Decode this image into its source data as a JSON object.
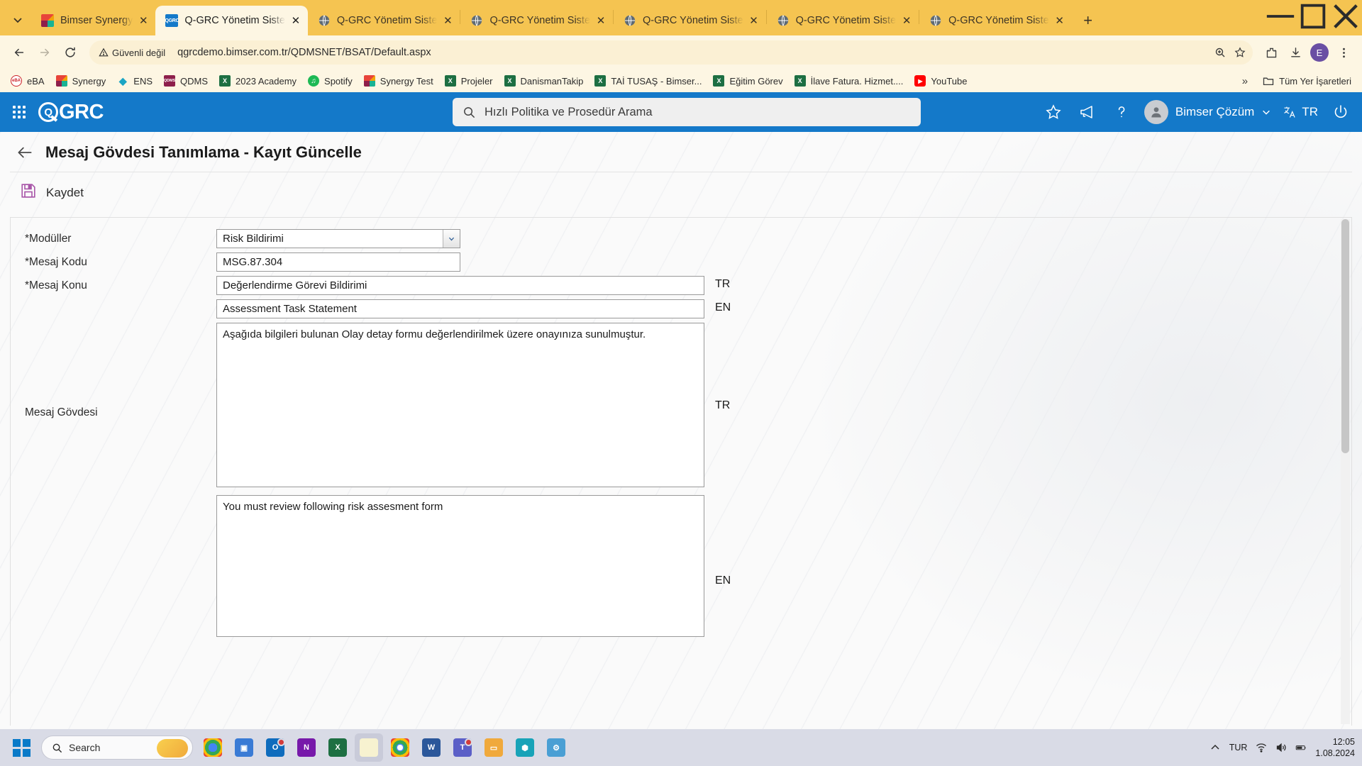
{
  "browser": {
    "tab_search_icon": "chevron-down-icon",
    "new_tab_label": "+",
    "tabs": [
      {
        "title": "Bimser Synergy",
        "favicon": "synergy-icon",
        "active": false
      },
      {
        "title": "Q-GRC Yönetim Siste",
        "favicon": "qgrc-icon",
        "active": true
      },
      {
        "title": "Q-GRC Yönetim Siste",
        "favicon": "globe-icon",
        "active": false
      },
      {
        "title": "Q-GRC Yönetim Siste",
        "favicon": "globe-icon",
        "active": false
      },
      {
        "title": "Q-GRC Yönetim Siste",
        "favicon": "globe-icon",
        "active": false
      },
      {
        "title": "Q-GRC Yönetim Siste",
        "favicon": "globe-icon",
        "active": false
      },
      {
        "title": "Q-GRC Yönetim Siste",
        "favicon": "globe-icon",
        "active": false
      }
    ],
    "window_controls": {
      "minimize": "minimize-icon",
      "maximize": "maximize-icon",
      "close": "close-icon"
    },
    "toolbar": {
      "back": "back-arrow-icon",
      "forward": "forward-arrow-icon",
      "reload": "reload-icon",
      "security_label": "Güvenli değil",
      "url": "qgrcdemo.bimser.com.tr/QDMSNET/BSAT/Default.aspx",
      "zoom_icon": "zoom-icon",
      "bookmark_star": "star-icon",
      "extensions": "extensions-icon",
      "downloads": "download-icon",
      "profile_initial": "E",
      "menu": "three-dot-menu-icon"
    },
    "bookmarks": [
      {
        "label": "eBA",
        "icon": "eba-icon"
      },
      {
        "label": "Synergy",
        "icon": "synergy-icon"
      },
      {
        "label": "ENS",
        "icon": "ens-icon"
      },
      {
        "label": "QDMS",
        "icon": "qdms-icon"
      },
      {
        "label": "2023 Academy",
        "icon": "excel-icon"
      },
      {
        "label": "Spotify",
        "icon": "spotify-icon"
      },
      {
        "label": "Synergy Test",
        "icon": "synergy-icon"
      },
      {
        "label": "Projeler",
        "icon": "excel-icon"
      },
      {
        "label": "DanismanTakip",
        "icon": "excel-icon"
      },
      {
        "label": "TAİ TUSAŞ - Bimser...",
        "icon": "excel-icon"
      },
      {
        "label": "Eğitim Görev",
        "icon": "excel-icon"
      },
      {
        "label": "İlave Fatura. Hizmet....",
        "icon": "excel-icon"
      },
      {
        "label": "YouTube",
        "icon": "youtube-icon"
      }
    ],
    "bookmarks_overflow": "»",
    "all_bookmarks_label": "Tüm Yer İşaretleri",
    "all_bookmarks_icon": "folder-icon"
  },
  "app_header": {
    "apps_grid_icon": "apps-grid-icon",
    "brand": "GRC",
    "brand_mark": "Q",
    "search_placeholder": "Hızlı Politika ve Prosedür Arama",
    "search_icon": "search-icon",
    "favorites_icon": "star-icon",
    "announcements_icon": "megaphone-icon",
    "help_icon": "question-mark-icon",
    "user_name": "Bimser Çözüm",
    "user_chevron": "chevron-down-icon",
    "language": "TR",
    "language_icon": "translate-icon",
    "power_icon": "power-icon"
  },
  "page": {
    "back_icon": "back-arrow-icon",
    "title": "Mesaj Gövdesi Tanımlama - Kayıt Güncelle",
    "save_label": "Kaydet",
    "save_icon": "floppy-disk-save-icon"
  },
  "form": {
    "fields": [
      {
        "label": "*Modüller",
        "value": "Risk Bildirimi",
        "type": "select"
      },
      {
        "label": "*Mesaj Kodu",
        "value": "MSG.87.304",
        "type": "text"
      },
      {
        "label": "*Mesaj Konu",
        "value": "Değerlendirme Görevi Bildirimi",
        "lang": "TR",
        "type": "text"
      },
      {
        "label": "",
        "value": "Assessment Task Statement",
        "lang": "EN",
        "type": "text"
      },
      {
        "label": "Mesaj Gövdesi",
        "value": "Aşağıda bilgileri bulunan Olay detay formu değerlendirilmek üzere onayınıza sunulmuştur.",
        "lang": "TR",
        "type": "textarea"
      },
      {
        "label": "",
        "value": "You must review following risk assesment form",
        "lang": "EN",
        "type": "textarea"
      }
    ],
    "dropdown_icon": "chevron-down-icon"
  },
  "taskbar": {
    "start_icon": "windows-logo-icon",
    "search_placeholder": "Search",
    "search_icon": "search-icon",
    "apps": [
      {
        "name": "chrome-beta-icon"
      },
      {
        "name": "task-view-icon"
      },
      {
        "name": "outlook-icon"
      },
      {
        "name": "onenote-icon"
      },
      {
        "name": "excel-icon"
      },
      {
        "name": "sticky-notes-icon"
      },
      {
        "name": "chrome-icon"
      },
      {
        "name": "word-icon"
      },
      {
        "name": "teams-icon"
      },
      {
        "name": "file-explorer-icon"
      },
      {
        "name": "shield-app-icon"
      },
      {
        "name": "settings-icon"
      }
    ],
    "show_hidden_icon": "chevron-up-icon",
    "language": "TUR",
    "wifi_icon": "wifi-icon",
    "volume_icon": "volume-icon",
    "battery_icon": "battery-icon",
    "time": "12:05",
    "date": "1.08.2024"
  },
  "colors": {
    "chrome_theme": "#f5c451",
    "chrome_surface": "#fdf6e3",
    "app_blue": "#1479c9",
    "save_purple": "#a855a8",
    "taskbar": "#d9dbe6"
  }
}
